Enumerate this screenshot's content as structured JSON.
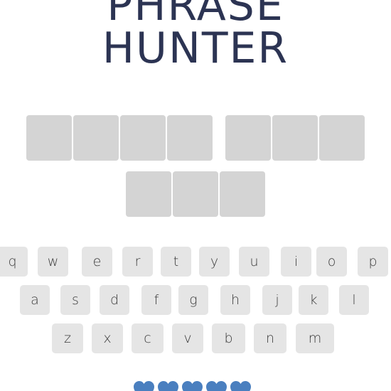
{
  "title": {
    "line1": "PHRASE",
    "line2": "HUNTER"
  },
  "phrase": {
    "rows": [
      {
        "words": [
          {
            "letters": [
              "",
              "",
              "",
              ""
            ]
          },
          {
            "letters": [
              "",
              "",
              ""
            ]
          }
        ]
      },
      {
        "words": [
          {
            "letters": [
              "",
              "",
              ""
            ]
          }
        ]
      }
    ]
  },
  "keyboard": {
    "rows": [
      [
        "q",
        "w",
        "e",
        "r",
        "t",
        "y",
        "u",
        "i",
        "o",
        "p"
      ],
      [
        "a",
        "s",
        "d",
        "f",
        "g",
        "h",
        "j",
        "k",
        "l"
      ],
      [
        "z",
        "x",
        "c",
        "v",
        "b",
        "n",
        "m"
      ]
    ]
  },
  "lives": {
    "total": 5,
    "remaining": 5,
    "color": "#4a7fbf"
  }
}
